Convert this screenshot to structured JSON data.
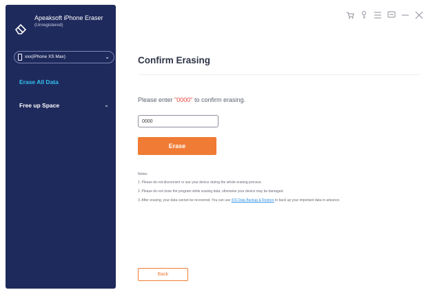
{
  "app": {
    "name": "Apeaksoft iPhone Eraser",
    "status": "(Unregistered)"
  },
  "device": {
    "selected": "xxx(iPhone XS Max)"
  },
  "sidebar": {
    "items": [
      {
        "label": "Erase All Data",
        "active": true
      },
      {
        "label": "Free up Space",
        "active": false
      }
    ]
  },
  "window_controls": {
    "icons": [
      "cart-icon",
      "key-icon",
      "menu-icon",
      "feedback-icon",
      "minimize-icon",
      "close-icon"
    ]
  },
  "main": {
    "title": "Confirm Erasing",
    "prompt_before": "Please enter ",
    "prompt_code": "\"0000\"",
    "prompt_after": " to confirm erasing.",
    "input_value": "0000",
    "erase_label": "Erase",
    "notes_title": "Notes:",
    "notes": [
      "1. Please do not disconnect or use your device during the whole erasing process.",
      "2. Please do not close the program while erasing data, otherwise your device may be damaged."
    ],
    "note3_before": "3. After erasing, your data cannot be recovered. You can use ",
    "note3_link": "iOS Data Backup & Restore",
    "note3_after": " to back up your important data in advance.",
    "back_label": "Back"
  },
  "colors": {
    "sidebar": "#1f2a5c",
    "accent": "#f07b34",
    "active_nav": "#31c0f2",
    "code": "#e8423a"
  }
}
